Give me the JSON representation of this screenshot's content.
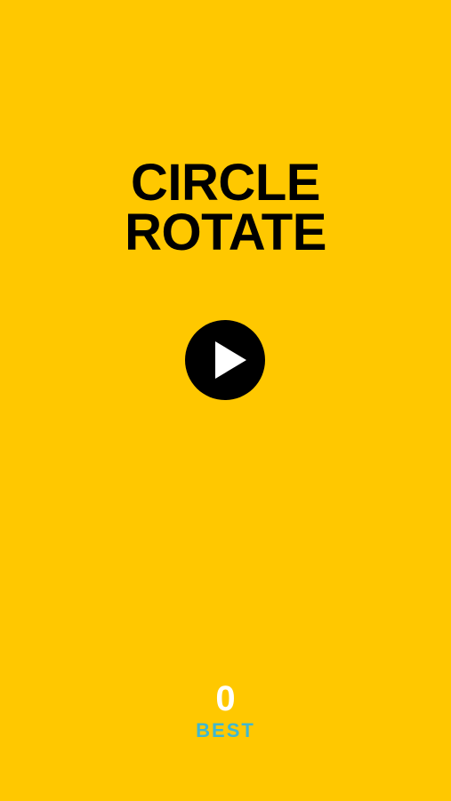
{
  "game": {
    "title_line1": "CIRCLE",
    "title_line2": "ROTATE",
    "play_icon": "play-icon",
    "best_score": "0",
    "best_label": "BEST"
  },
  "colors": {
    "background": "#FFC800",
    "title": "#000000",
    "play_button": "#000000",
    "play_icon": "#FFFFFF",
    "best_score": "#FFFFFF",
    "best_label": "#3FB8D0"
  }
}
